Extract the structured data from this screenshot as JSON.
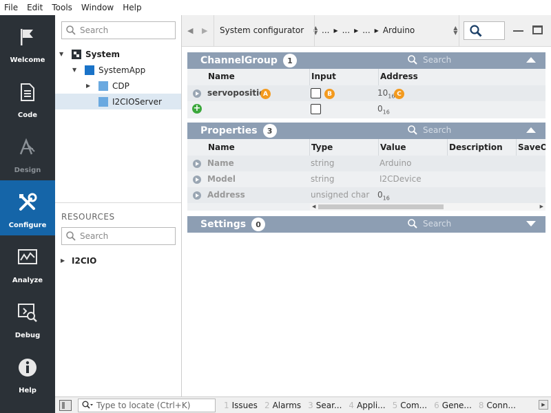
{
  "menubar": {
    "file": "File",
    "edit": "Edit",
    "tools": "Tools",
    "window": "Window",
    "help": "Help"
  },
  "sidebar": {
    "items": [
      {
        "label": "Welcome",
        "icon": "flag-icon"
      },
      {
        "label": "Code",
        "icon": "document-icon"
      },
      {
        "label": "Design",
        "icon": "design-icon"
      },
      {
        "label": "Configure",
        "icon": "tools-icon"
      },
      {
        "label": "Analyze",
        "icon": "chart-icon"
      },
      {
        "label": "Debug",
        "icon": "debug-icon"
      },
      {
        "label": "Help",
        "icon": "info-icon"
      }
    ]
  },
  "tree": {
    "search_placeholder": "Search",
    "nodes": [
      "System",
      "SystemApp",
      "CDP",
      "I2CIOServer"
    ]
  },
  "resources": {
    "label": "RESOURCES",
    "search_placeholder": "Search",
    "items": [
      "I2CIO"
    ]
  },
  "toolbar": {
    "view": "System configurator",
    "breadcrumb": [
      "...",
      "...",
      "...",
      "Arduino"
    ]
  },
  "channelgroup": {
    "title": "ChannelGroup",
    "count": "1",
    "search": "Search",
    "headers": [
      "Name",
      "Input",
      "Address"
    ],
    "row": {
      "name": "servoposition",
      "address": "10",
      "address_sub": "16",
      "badges": [
        "A",
        "B",
        "C"
      ]
    },
    "new_row": {
      "address": "0",
      "address_sub": "16"
    }
  },
  "properties": {
    "title": "Properties",
    "count": "3",
    "search": "Search",
    "headers": [
      "Name",
      "Type",
      "Value",
      "Description",
      "SaveOr"
    ],
    "rows": [
      {
        "name": "Name",
        "type": "string",
        "value": "Arduino"
      },
      {
        "name": "Model",
        "type": "string",
        "value": "I2CDevice"
      },
      {
        "name": "Address",
        "type": "unsigned char",
        "value": "0",
        "value_sub": "16"
      }
    ]
  },
  "settings": {
    "title": "Settings",
    "count": "0",
    "search": "Search"
  },
  "statusbar": {
    "locate_placeholder": "Type to locate (Ctrl+K)",
    "tabs": [
      {
        "num": "1",
        "label": "Issues"
      },
      {
        "num": "2",
        "label": "Alarms"
      },
      {
        "num": "3",
        "label": "Sear..."
      },
      {
        "num": "4",
        "label": "Appli..."
      },
      {
        "num": "5",
        "label": "Com..."
      },
      {
        "num": "6",
        "label": "Gene..."
      },
      {
        "num": "8",
        "label": "Conn..."
      }
    ]
  },
  "colors": {
    "sidebar": "#2b3137",
    "active": "#1565a8",
    "section_header": "#8d9eb3",
    "badge": "#f39a1e",
    "add": "#3ca83c"
  }
}
